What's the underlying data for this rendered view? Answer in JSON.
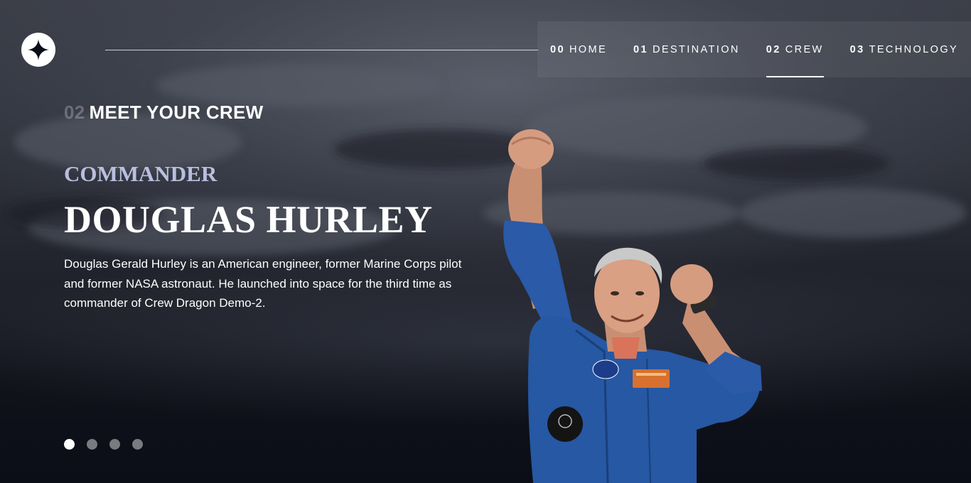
{
  "nav": {
    "items": [
      {
        "num": "00",
        "label": "HOME"
      },
      {
        "num": "01",
        "label": "DESTINATION"
      },
      {
        "num": "02",
        "label": "CREW"
      },
      {
        "num": "03",
        "label": "TECHNOLOGY"
      }
    ],
    "active_index": 2
  },
  "page": {
    "heading_num": "02",
    "heading_label": "MEET YOUR CREW"
  },
  "crew": {
    "role": "COMMANDER",
    "name": "DOUGLAS HURLEY",
    "bio": "Douglas Gerald Hurley is an American engineer, former Marine Corps pilot and former NASA astronaut. He launched into space for the third time as commander of Crew Dragon Demo-2."
  },
  "slider": {
    "count": 4,
    "active_index": 0
  },
  "icons": {
    "logo": "star-logo-icon"
  },
  "colors": {
    "background": "#0b0d17",
    "accent_light": "#d0d6f9",
    "white": "#ffffff"
  }
}
